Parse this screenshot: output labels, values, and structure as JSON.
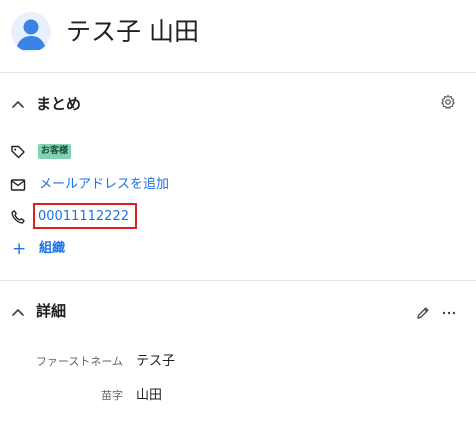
{
  "contact": {
    "name": "テス子 山田"
  },
  "summary": {
    "title": "まとめ",
    "tag_badge": "お客様",
    "add_email_label": "メールアドレスを追加",
    "phone": "00011112222",
    "organization_label": "組織"
  },
  "details": {
    "title": "詳細",
    "fields": [
      {
        "label": "ファーストネーム",
        "value": "テス子"
      },
      {
        "label": "苗字",
        "value": "山田"
      }
    ]
  },
  "colors": {
    "link": "#1a73e8",
    "badge_bg": "#7fd3b3",
    "highlight_border": "#e11d24",
    "avatar": "#3b82e6"
  },
  "icons": {
    "avatar": "person-icon",
    "collapse": "chevron-up-icon",
    "settings": "gear-icon",
    "tag": "tag-icon",
    "email": "envelope-icon",
    "phone": "phone-icon",
    "add": "plus-icon",
    "edit": "pencil-icon",
    "more": "more-horizontal-icon"
  }
}
